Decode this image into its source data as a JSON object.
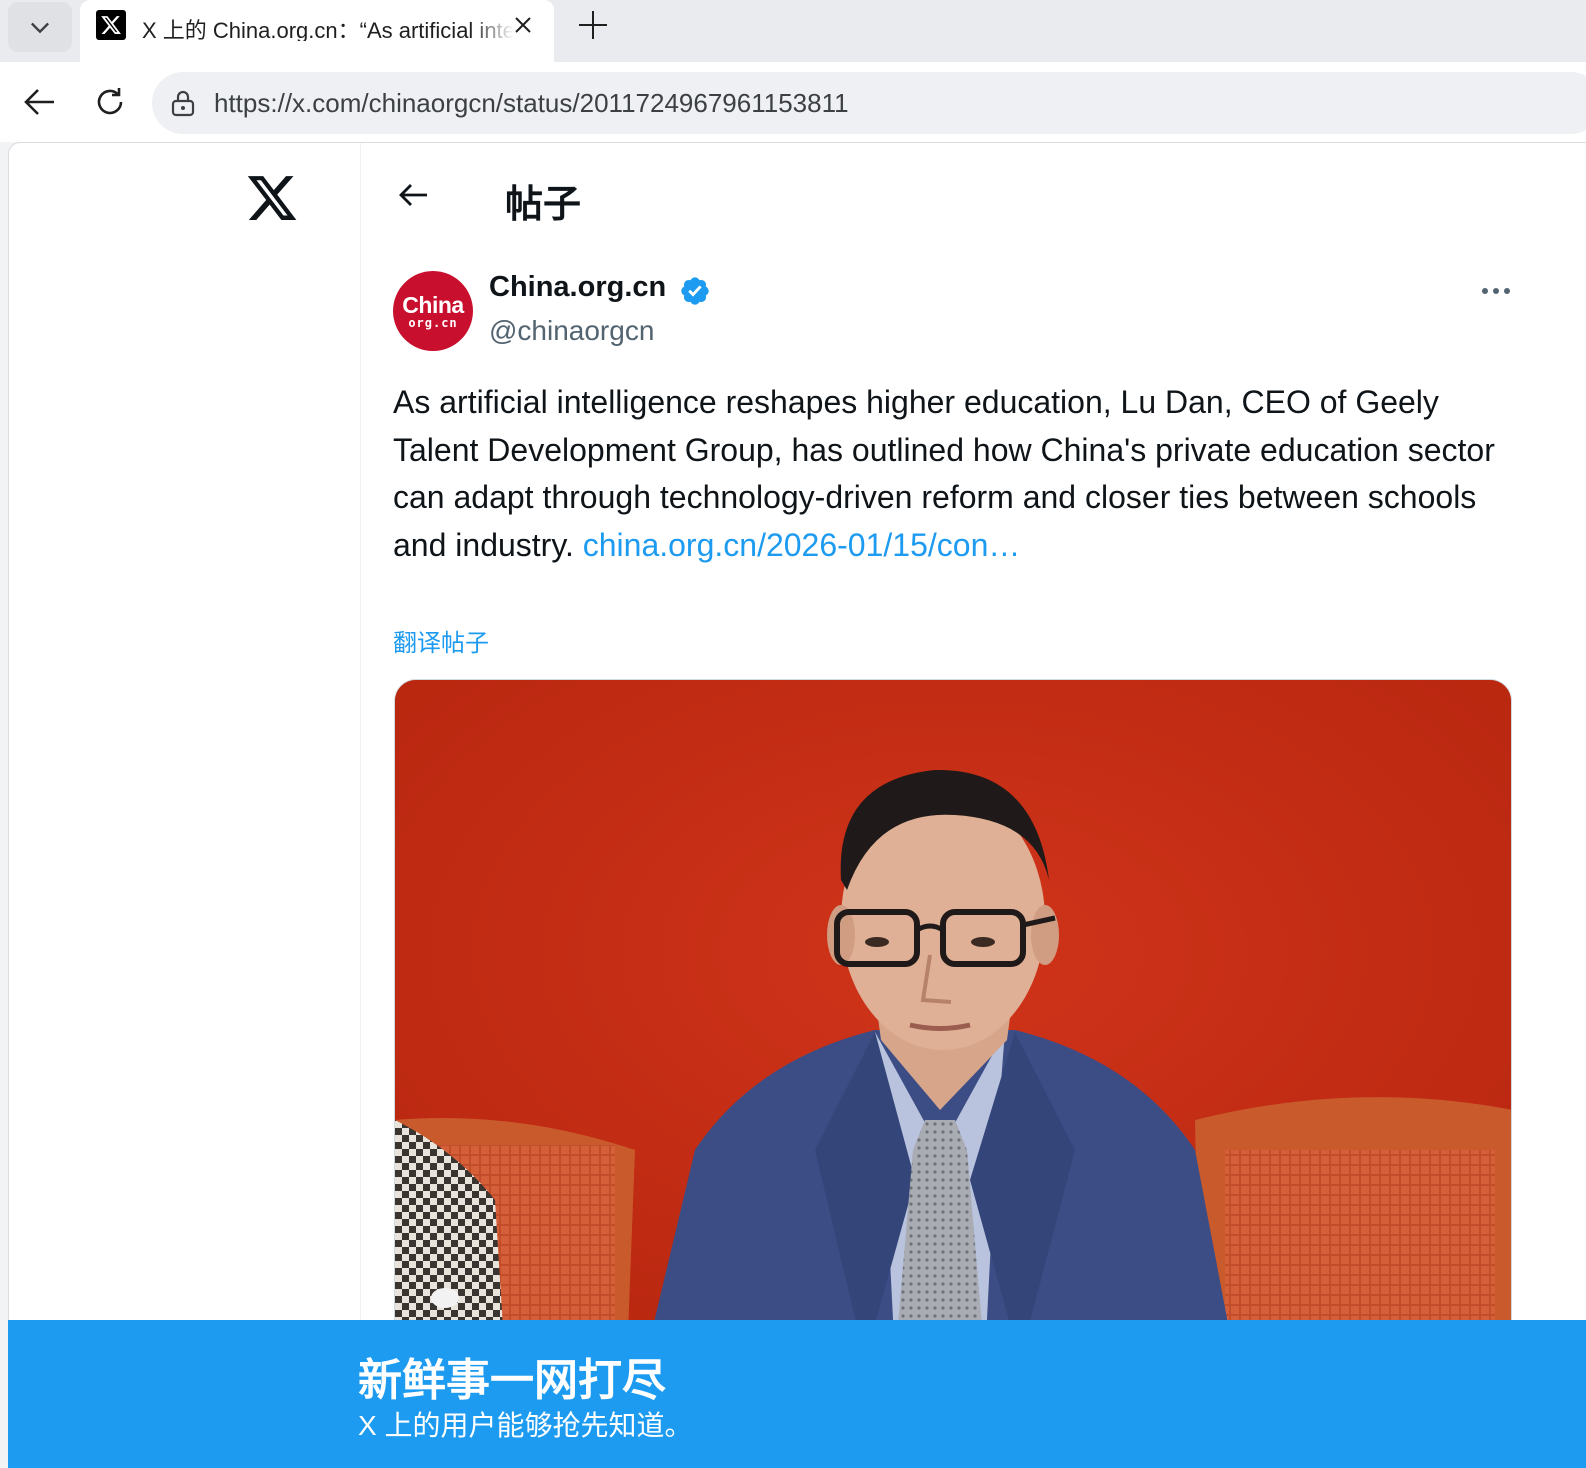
{
  "browser": {
    "tab": {
      "title": "X 上的 China.org.cn：“As artificial intelligence reshapes higher education",
      "favicon": "x-logo-icon"
    },
    "address_bar": {
      "url": "https://x.com/chinaorgcn/status/2011724967961153811"
    },
    "icons": {
      "tab_menu": "chevron-down-icon",
      "tab_close": "close-icon",
      "new_tab": "plus-icon",
      "back": "arrow-left-icon",
      "reload": "reload-icon",
      "site_info": "lock-icon"
    }
  },
  "page": {
    "header": {
      "title": "帖子",
      "back_icon": "arrow-left-icon"
    },
    "post": {
      "author": {
        "display_name": "China.org.cn",
        "handle": "@chinaorgcn",
        "verified": true,
        "avatar_logo": {
          "top": "China",
          "bottom": "org.cn"
        }
      },
      "text": "As artificial intelligence reshapes higher education, Lu Dan, CEO of Geely Talent Development Group, has outlined how China's private education sector can adapt through technology-driven reform and closer ties between schools and industry. ",
      "link_text": "china.org.cn/2026-01/15/con…",
      "translate_label": "翻译帖子",
      "more_icon": "more-horizontal-icon"
    },
    "signup_banner": {
      "title": "新鲜事一网打尽",
      "subtitle": "X 上的用户能够抢先知道。"
    }
  },
  "colors": {
    "accent": "#1d9bf0",
    "text_primary": "#0f1419",
    "text_secondary": "#536471",
    "avatar_red": "#c8102e",
    "photo_background": "#c9301a"
  }
}
